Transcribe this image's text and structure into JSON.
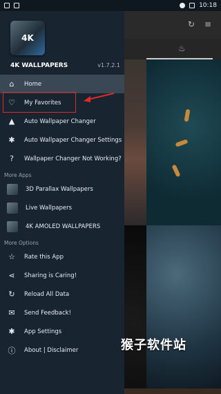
{
  "status_bar": {
    "time": "10:18"
  },
  "background": {
    "watermark": "猴子软件站"
  },
  "drawer": {
    "app_title": "4K WALLPAPERS",
    "version": "v1.7.2.1",
    "logo_text": "4K",
    "items": [
      {
        "label": "Home",
        "icon": "home-icon",
        "glyph": "⌂"
      },
      {
        "label": "My Favorites",
        "icon": "heart-icon",
        "glyph": "♡"
      },
      {
        "label": "Auto Wallpaper Changer",
        "icon": "mountain-icon",
        "glyph": "▲"
      },
      {
        "label": "Auto Wallpaper Changer Settings",
        "icon": "gear-icon",
        "glyph": "✱"
      },
      {
        "label": "Wallpaper Changer Not Working?",
        "icon": "question-icon",
        "glyph": "?"
      }
    ],
    "more_apps_label": "More Apps",
    "more_apps": [
      {
        "label": "3D Parallax Wallpapers",
        "icon": "parallax-app-icon"
      },
      {
        "label": "Live Wallpapers",
        "icon": "live-app-icon"
      },
      {
        "label": "4K AMOLED WALLPAPERS",
        "icon": "amoled-app-icon"
      }
    ],
    "more_options_label": "More Options",
    "more_options": [
      {
        "label": "Rate this App",
        "icon": "star-icon",
        "glyph": "☆"
      },
      {
        "label": "Sharing is Caring!",
        "icon": "share-icon",
        "glyph": "⋖"
      },
      {
        "label": "Reload All Data",
        "icon": "reload-icon",
        "glyph": "↻"
      },
      {
        "label": "Send Feedback!",
        "icon": "feedback-icon",
        "glyph": "✉"
      },
      {
        "label": "App Settings",
        "icon": "settings-icon",
        "glyph": "✱"
      },
      {
        "label": "About | Disclaimer",
        "icon": "info-icon",
        "glyph": "ⓘ"
      }
    ]
  },
  "colors": {
    "drawer_bg": "#182430",
    "active_item_bg": "#3a4754",
    "highlight": "#e02a2a"
  }
}
